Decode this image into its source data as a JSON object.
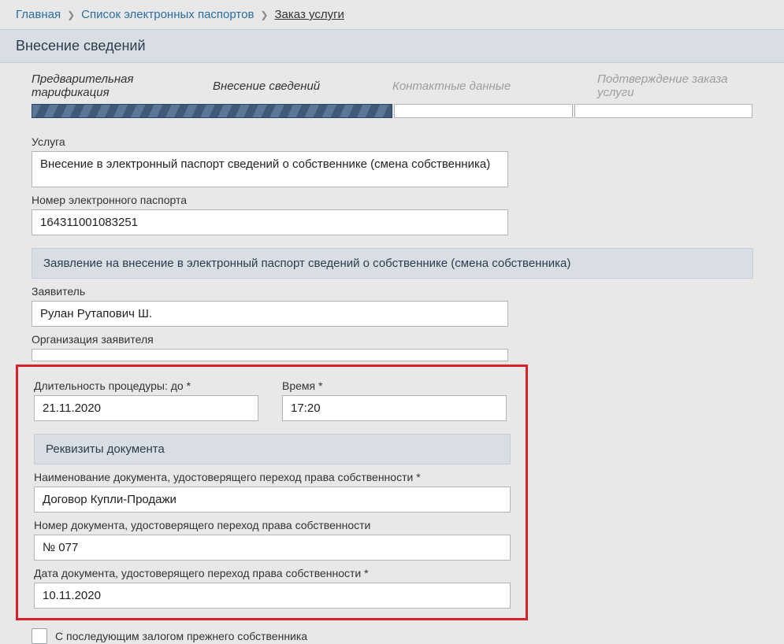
{
  "breadcrumb": {
    "home": "Главная",
    "list": "Список электронных паспортов",
    "order": "Заказ услуги"
  },
  "page_title": "Внесение сведений",
  "wizard": {
    "step1": "Предварительная тарификация",
    "step2": "Внесение сведений",
    "step3": "Контактные данные",
    "step4": "Подтверждение заказа услуги"
  },
  "labels": {
    "service": "Услуга",
    "passport_num": "Номер электронного паспорта",
    "applicant": "Заявитель",
    "applicant_org": "Организация заявителя",
    "duration": "Длительность процедуры: до *",
    "time": "Время *",
    "doc_name": "Наименование документа, удостоверящего переход права собственности *",
    "doc_num": "Номер документа, удостоверящего переход права собственности",
    "doc_date": "Дата документа, удостоверящего переход права собственности *",
    "pledge_checkbox": "С последующим залогом прежнего собственника"
  },
  "values": {
    "service": "Внесение в электронный паспорт сведений о собственнике (смена собственника)",
    "passport_num": "164311001083251",
    "applicant": "Рулан Рутапович Ш.",
    "applicant_org": "",
    "duration": "21.11.2020",
    "time": "17:20",
    "doc_name": "Договор Купли-Продажи",
    "doc_num": "№ 077",
    "doc_date": "10.11.2020"
  },
  "section_headers": {
    "application": "Заявление на внесение в электронный паспорт сведений о собственнике (смена собственника)",
    "doc_details": "Реквизиты документа"
  }
}
